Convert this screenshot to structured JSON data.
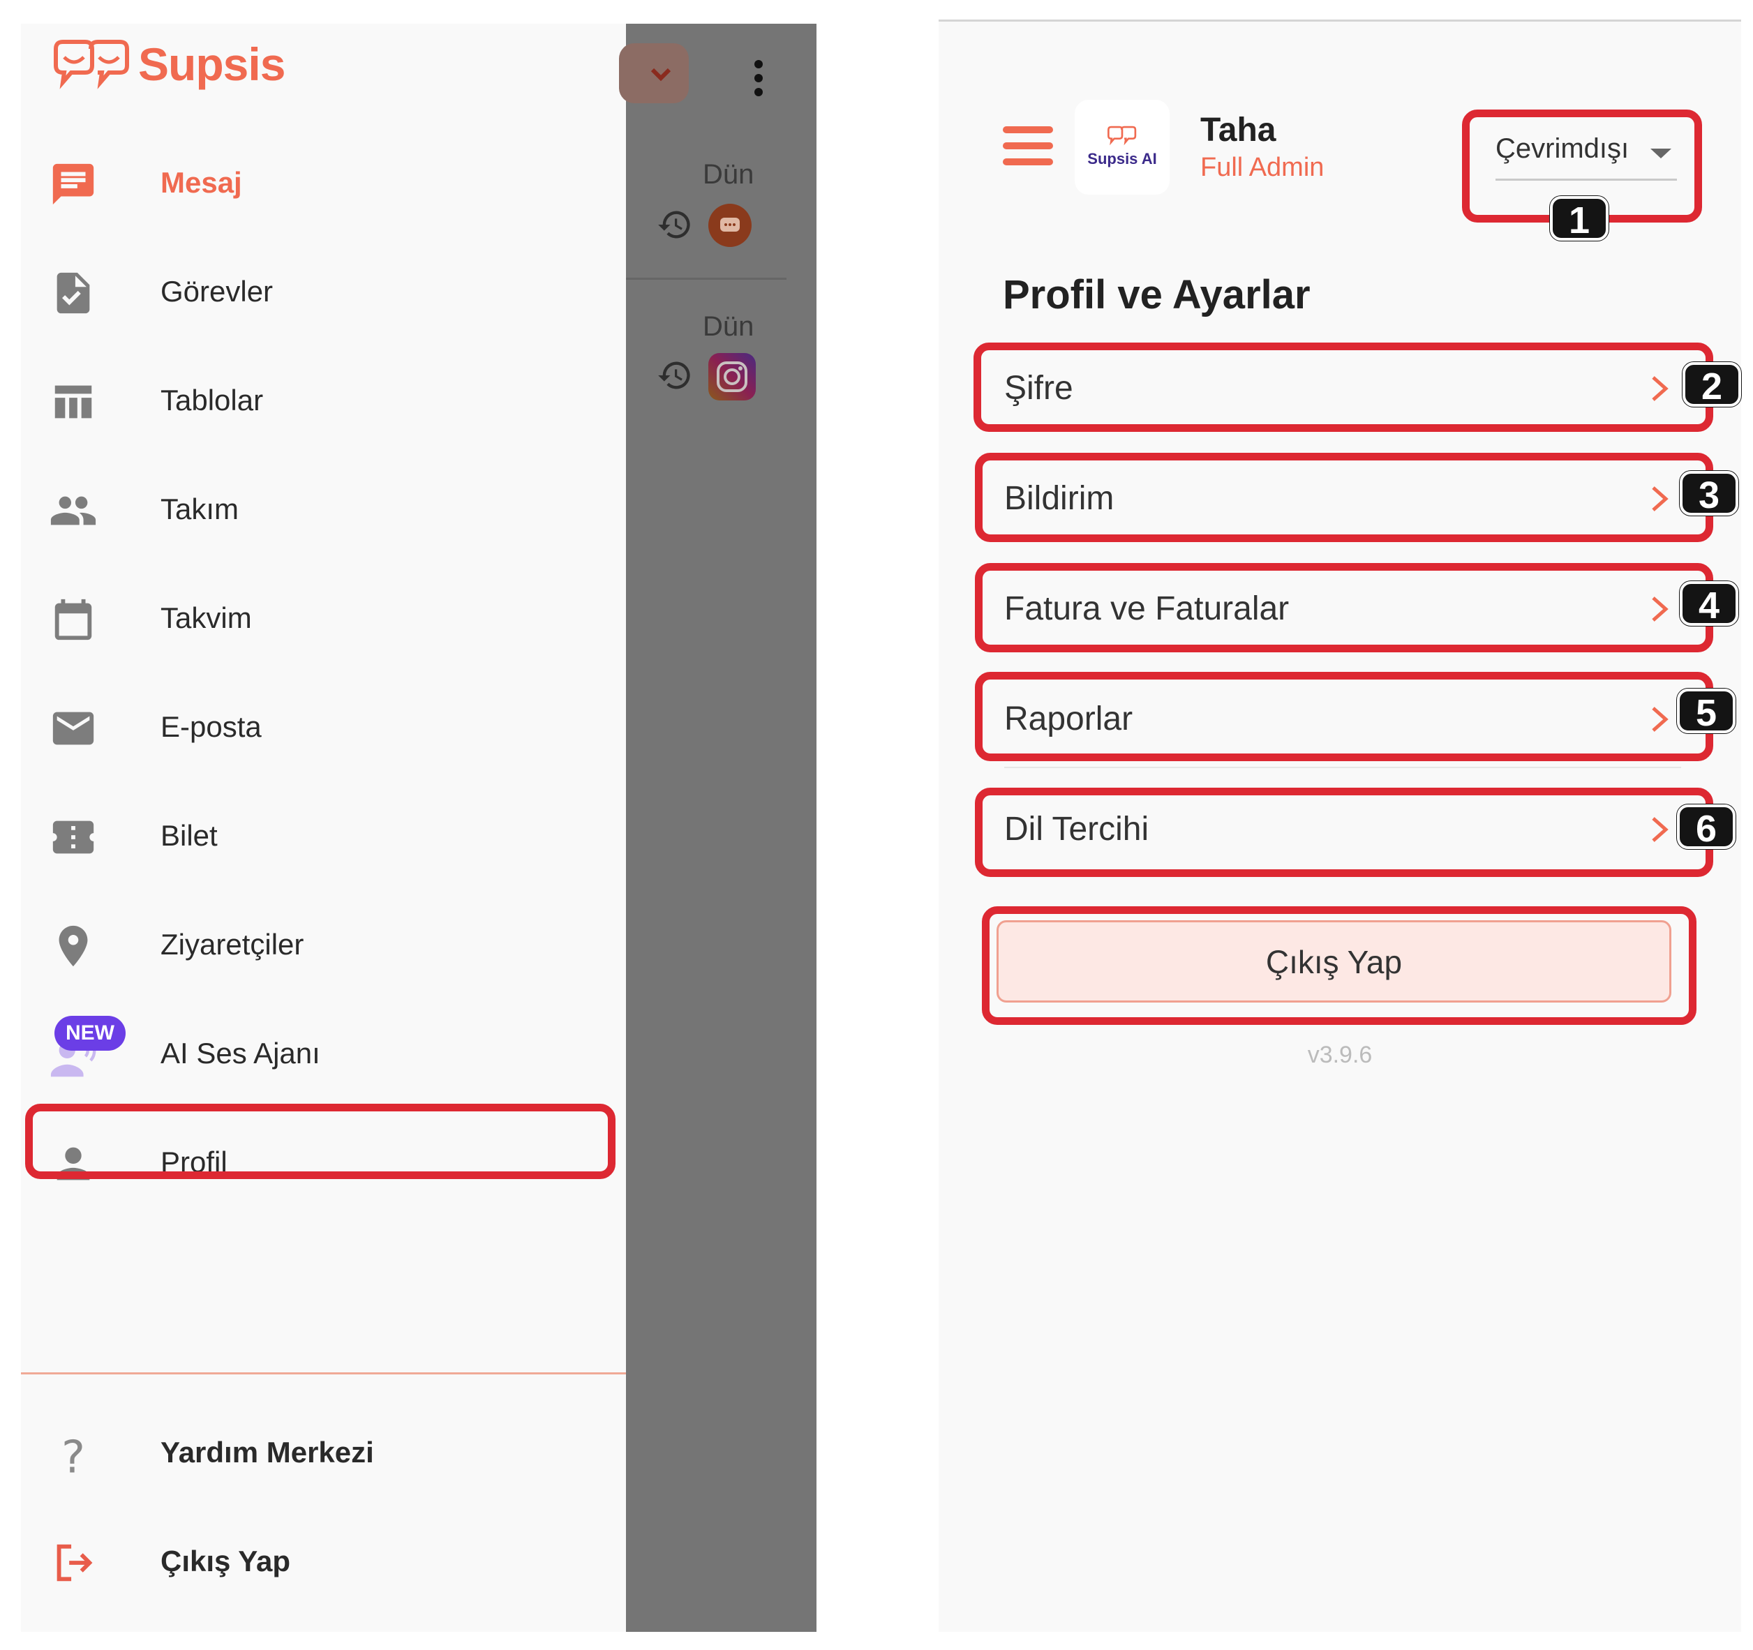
{
  "left": {
    "brand": "Supsis",
    "nav": [
      {
        "label": "Mesaj",
        "icon": "message-icon"
      },
      {
        "label": "Görevler",
        "icon": "task-icon"
      },
      {
        "label": "Tablolar",
        "icon": "table-icon"
      },
      {
        "label": "Takım",
        "icon": "team-icon"
      },
      {
        "label": "Takvim",
        "icon": "calendar-icon"
      },
      {
        "label": "E-posta",
        "icon": "mail-icon"
      },
      {
        "label": "Bilet",
        "icon": "ticket-icon"
      },
      {
        "label": "Ziyaretçiler",
        "icon": "location-pin-icon"
      },
      {
        "label": "AI Ses Ajanı",
        "icon": "voice-agent-icon",
        "badge": "NEW"
      },
      {
        "label": "Profil",
        "icon": "person-icon"
      }
    ],
    "footer": [
      {
        "label": "Yardım Merkezi",
        "icon": "help-icon"
      },
      {
        "label": "Çıkış Yap",
        "icon": "logout-icon"
      }
    ],
    "background_list": [
      {
        "time": "Dün",
        "channel": "chat"
      },
      {
        "time": "Dün",
        "channel": "instagram"
      }
    ],
    "accent": "#f06a50"
  },
  "right": {
    "user": {
      "name": "Taha",
      "role": "Full Admin",
      "logo_text": "Supsis AI"
    },
    "status": {
      "value": "Çevrimdışı"
    },
    "section_title": "Profil ve Ayarlar",
    "items": [
      {
        "label": "Şifre",
        "annotation": "2"
      },
      {
        "label": "Bildirim",
        "annotation": "3"
      },
      {
        "label": "Fatura ve Faturalar",
        "annotation": "4"
      },
      {
        "label": "Raporlar",
        "annotation": "5"
      },
      {
        "label": "Dil Tercihi",
        "annotation": "6"
      }
    ],
    "logout_label": "Çıkış Yap",
    "version": "v3.9.6",
    "status_annotation": "1"
  }
}
